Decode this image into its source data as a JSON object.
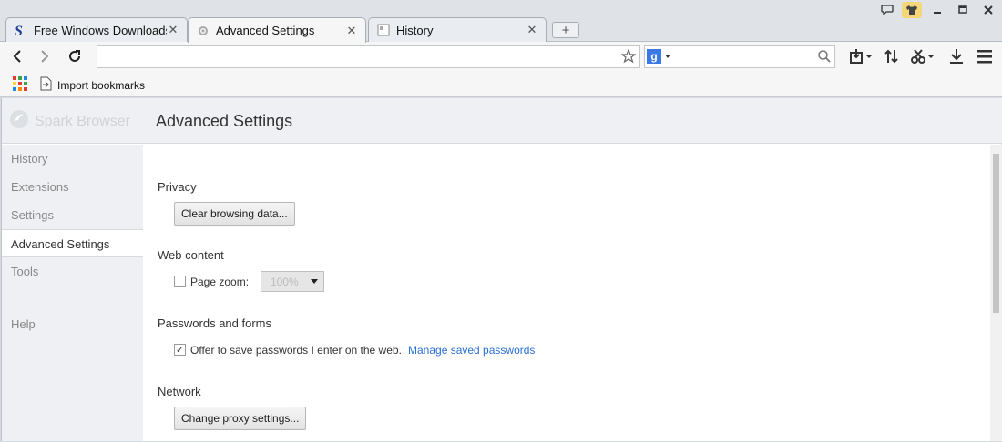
{
  "tabs": [
    {
      "title": "Free Windows Downloads",
      "icon": "softpedia-icon"
    },
    {
      "title": "Advanced Settings",
      "icon": "gear-icon"
    },
    {
      "title": "History",
      "icon": "history-page-icon"
    }
  ],
  "new_tab_label": "+",
  "omnibox": {
    "value": "",
    "placeholder": ""
  },
  "search": {
    "value": "",
    "engine": "Google"
  },
  "bookmarks": {
    "import_label": "Import bookmarks"
  },
  "brand": {
    "name": "Spark Browser"
  },
  "page_title": "Advanced Settings",
  "sidebar": {
    "items": [
      {
        "label": "History"
      },
      {
        "label": "Extensions"
      },
      {
        "label": "Settings"
      },
      {
        "label": "Advanced Settings"
      },
      {
        "label": "Tools"
      },
      {
        "label": "Help"
      }
    ]
  },
  "sections": {
    "privacy": {
      "title": "Privacy",
      "button": "Clear browsing data..."
    },
    "web_content": {
      "title": "Web content",
      "zoom_label": "Page zoom:",
      "zoom_value": "100%",
      "zoom_checked": false
    },
    "passwords": {
      "title": "Passwords and forms",
      "offer_label": "Offer to save passwords I enter on the web.",
      "offer_checked": true,
      "manage_link": "Manage saved passwords"
    },
    "network": {
      "title": "Network",
      "button": "Change proxy settings..."
    }
  },
  "colors": {
    "accent": "#2a6fd6",
    "header_bg": "#eef0f3"
  }
}
